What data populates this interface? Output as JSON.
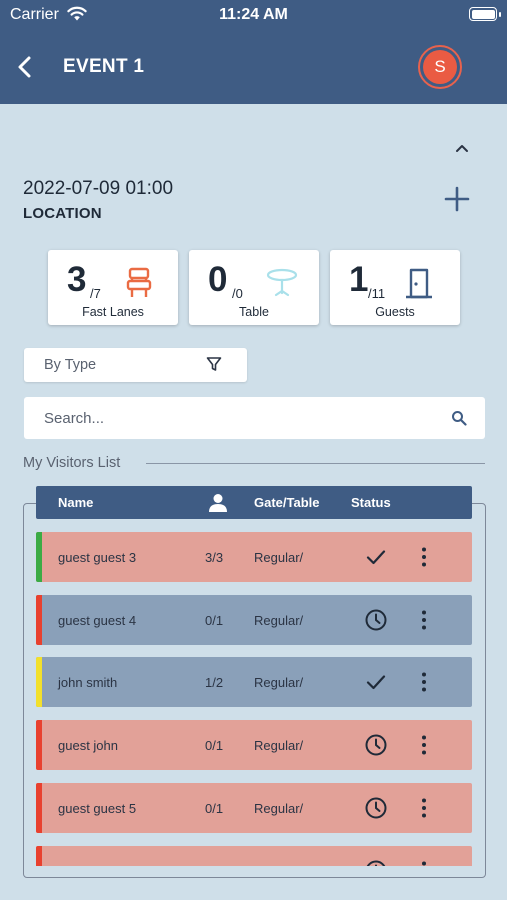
{
  "status_bar": {
    "carrier": "Carrier",
    "time": "11:24 AM"
  },
  "header": {
    "title": "EVENT 1",
    "avatar_initial": "S"
  },
  "event": {
    "datetime": "2022-07-09 01:00",
    "location": "LOCATION"
  },
  "stats": [
    {
      "value": "3",
      "total": "/7",
      "label": "Fast Lanes",
      "icon": "chair-icon",
      "icon_color": "#ea6b43"
    },
    {
      "value": "0",
      "total": "/0",
      "label": "Table",
      "icon": "table-icon",
      "icon_color": "#a9e0ea"
    },
    {
      "value": "1",
      "total": "/11",
      "label": "Guests",
      "icon": "door-icon",
      "icon_color": "#3f5c84"
    }
  ],
  "filter": {
    "label": "By Type"
  },
  "search": {
    "placeholder": "Search..."
  },
  "visitors": {
    "section_title": "My Visitors List",
    "columns": {
      "name": "Name",
      "gate": "Gate/Table",
      "status": "Status"
    },
    "rows": [
      {
        "name": "guest guest 3",
        "count": "3/3",
        "gate": "Regular/",
        "status": "checked",
        "bg": "#e2a198",
        "accent": "#3bab45"
      },
      {
        "name": "guest guest 4",
        "count": "0/1",
        "gate": "Regular/",
        "status": "pending",
        "bg": "#8aa0b9",
        "accent": "#e8412f"
      },
      {
        "name": "john smith",
        "count": "1/2",
        "gate": "Regular/",
        "status": "checked",
        "bg": "#8aa0b9",
        "accent": "#f2e02c"
      },
      {
        "name": "guest john",
        "count": "0/1",
        "gate": "Regular/",
        "status": "pending",
        "bg": "#e2a198",
        "accent": "#e8412f"
      },
      {
        "name": "guest guest 5",
        "count": "0/1",
        "gate": "Regular/",
        "status": "pending",
        "bg": "#e2a198",
        "accent": "#e8412f"
      },
      {
        "name": "",
        "count": "",
        "gate": "",
        "status": "pending",
        "bg": "#e2a198",
        "accent": "#e8412f"
      }
    ]
  },
  "colors": {
    "header": "#3f5c84",
    "background": "#cfdfe9",
    "avatar": "#ea5b43"
  }
}
